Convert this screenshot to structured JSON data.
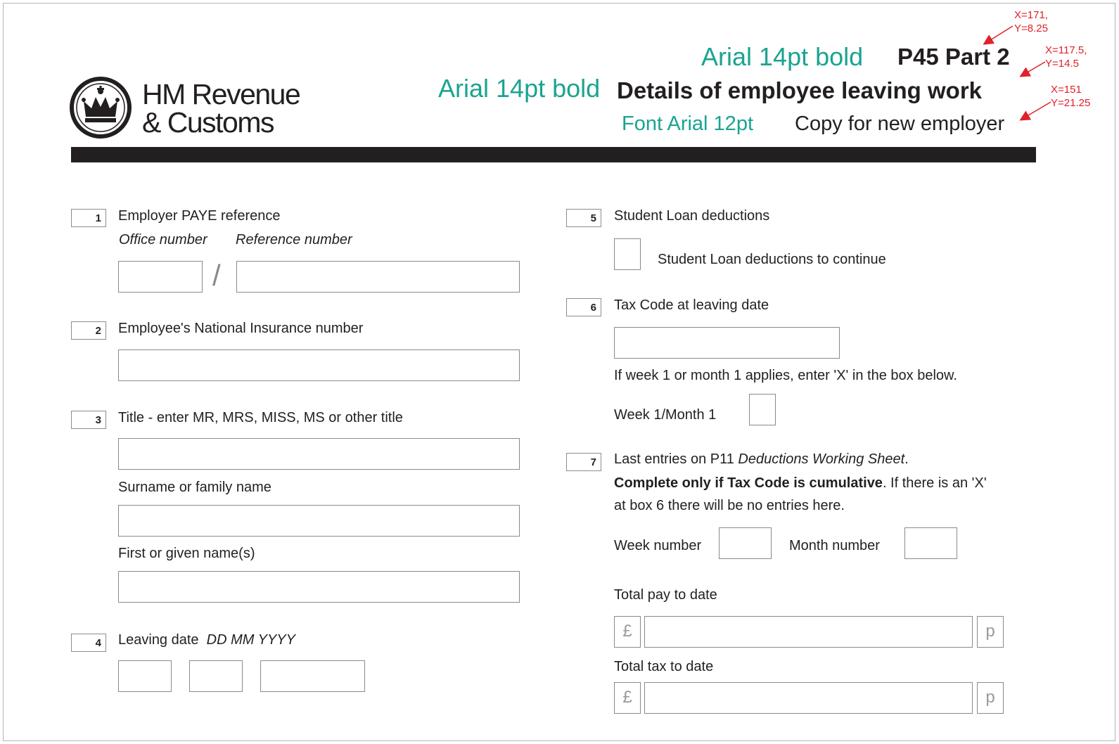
{
  "logo": {
    "line1": "HM Revenue",
    "line2": "& Customs"
  },
  "header": {
    "annotation_title": "Arial 14pt bold",
    "form_title": "P45 Part 2",
    "annotation_subtitle": "Arial 14pt bold",
    "subtitle": "Details of employee leaving work",
    "annotation_copy": "Font Arial 12pt",
    "copy_label": "Copy for new employer"
  },
  "coords": {
    "title": {
      "line1": "X=171,",
      "line2": "Y=8.25"
    },
    "subtitle": {
      "line1": "X=117.5,",
      "line2": "Y=14.5"
    },
    "copy": {
      "line1": "X=151",
      "line2": "Y=21.25"
    }
  },
  "colors": {
    "annotation": "#1aa490",
    "coordinate_marker": "#e0202a",
    "header_rule": "#231f20"
  },
  "q1": {
    "number": "1",
    "label": "Employer PAYE reference",
    "sub_office": "Office number",
    "sub_reference": "Reference number",
    "separator": "/"
  },
  "q2": {
    "number": "2",
    "label": "Employee's National Insurance number"
  },
  "q3": {
    "number": "3",
    "label": "Title - enter MR, MRS, MISS, MS or other title",
    "surname_label": "Surname or family name",
    "firstname_label": "First or given name(s)"
  },
  "q4": {
    "number": "4",
    "label": "Leaving date",
    "format": "DD MM YYYY"
  },
  "q5": {
    "number": "5",
    "label": "Student Loan deductions",
    "checkbox_label": "Student Loan deductions to continue"
  },
  "q6": {
    "number": "6",
    "label": "Tax Code at leaving date",
    "note": "If week 1 or month 1 applies, enter 'X' in the box below.",
    "week1_label": "Week 1/Month 1"
  },
  "q7": {
    "number": "7",
    "label_prefix": "Last entries on P11 ",
    "label_italic": "Deductions Working Sheet",
    "label_suffix": ".",
    "note_bold": "Complete only if Tax Code is cumulative",
    "note_rest": ". If there is an 'X'",
    "note_line2": "at box 6 there will be no entries here.",
    "week_number_label": "Week number",
    "month_number_label": "Month number",
    "total_pay_label": "Total pay to date",
    "total_tax_label": "Total tax to date",
    "pound": "£",
    "pence": "p"
  }
}
